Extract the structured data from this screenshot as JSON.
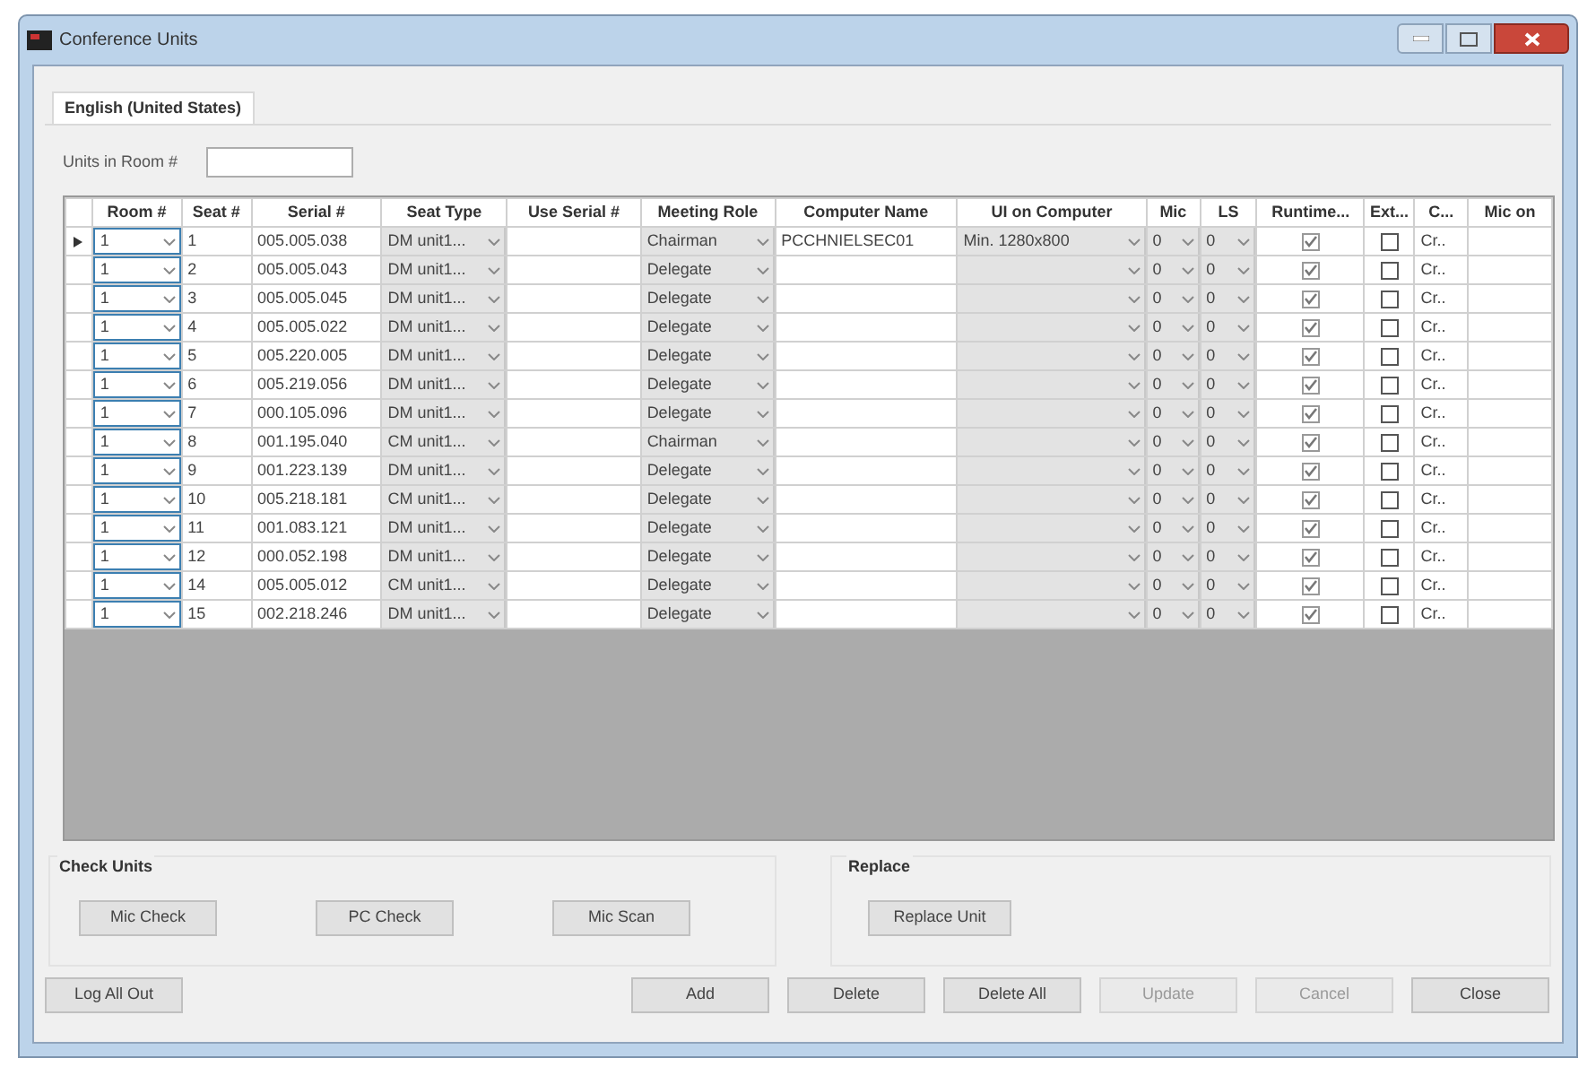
{
  "window": {
    "title": "Conference Units"
  },
  "tab": {
    "label": "English (United States)",
    "selected": true
  },
  "units_in_room": {
    "label": "Units in Room #"
  },
  "table": {
    "columns": [
      {
        "label": "Room #"
      },
      {
        "label": "Seat #"
      },
      {
        "label": "Serial #"
      },
      {
        "label": "Seat Type"
      },
      {
        "label": "Use Serial #"
      },
      {
        "label": "Meeting Role"
      },
      {
        "label": "Computer Name"
      },
      {
        "label": "UI on Computer"
      },
      {
        "label": "Mic"
      },
      {
        "label": "LS"
      },
      {
        "label": "Runtime..."
      },
      {
        "label": "Ext..."
      },
      {
        "label": "C..."
      },
      {
        "label": "Mic on"
      }
    ],
    "rows": [
      {
        "selected": true,
        "room": "1",
        "seat": "1",
        "serial": "005.005.038",
        "seat_type": "DM unit1...",
        "meeting_role": "Chairman",
        "computer_name": "PCCHNIELSEC01",
        "ui_on_computer": "Min. 1280x800",
        "mic": "0",
        "ls": "0",
        "runtime": true,
        "ext": false,
        "c": "Cr.."
      },
      {
        "selected": false,
        "room": "1",
        "seat": "2",
        "serial": "005.005.043",
        "seat_type": "DM unit1...",
        "meeting_role": "Delegate",
        "mic": "0",
        "ls": "0",
        "runtime": true,
        "ext": false,
        "c": "Cr.."
      },
      {
        "selected": false,
        "room": "1",
        "seat": "3",
        "serial": "005.005.045",
        "seat_type": "DM unit1...",
        "meeting_role": "Delegate",
        "mic": "0",
        "ls": "0",
        "runtime": true,
        "ext": false,
        "c": "Cr.."
      },
      {
        "selected": false,
        "room": "1",
        "seat": "4",
        "serial": "005.005.022",
        "seat_type": "DM unit1...",
        "meeting_role": "Delegate",
        "mic": "0",
        "ls": "0",
        "runtime": true,
        "ext": false,
        "c": "Cr.."
      },
      {
        "selected": false,
        "room": "1",
        "seat": "5",
        "serial": "005.220.005",
        "seat_type": "DM unit1...",
        "meeting_role": "Delegate",
        "mic": "0",
        "ls": "0",
        "runtime": true,
        "ext": false,
        "c": "Cr.."
      },
      {
        "selected": false,
        "room": "1",
        "seat": "6",
        "serial": "005.219.056",
        "seat_type": "DM unit1...",
        "meeting_role": "Delegate",
        "mic": "0",
        "ls": "0",
        "runtime": true,
        "ext": false,
        "c": "Cr.."
      },
      {
        "selected": false,
        "room": "1",
        "seat": "7",
        "serial": "000.105.096",
        "seat_type": "DM unit1...",
        "meeting_role": "Delegate",
        "mic": "0",
        "ls": "0",
        "runtime": true,
        "ext": false,
        "c": "Cr.."
      },
      {
        "selected": false,
        "room": "1",
        "seat": "8",
        "serial": "001.195.040",
        "seat_type": "CM unit1...",
        "meeting_role": "Chairman",
        "mic": "0",
        "ls": "0",
        "runtime": true,
        "ext": false,
        "c": "Cr.."
      },
      {
        "selected": false,
        "room": "1",
        "seat": "9",
        "serial": "001.223.139",
        "seat_type": "DM unit1...",
        "meeting_role": "Delegate",
        "mic": "0",
        "ls": "0",
        "runtime": true,
        "ext": false,
        "c": "Cr.."
      },
      {
        "selected": false,
        "room": "1",
        "seat": "10",
        "serial": "005.218.181",
        "seat_type": "CM unit1...",
        "meeting_role": "Delegate",
        "mic": "0",
        "ls": "0",
        "runtime": true,
        "ext": false,
        "c": "Cr.."
      },
      {
        "selected": false,
        "room": "1",
        "seat": "11",
        "serial": "001.083.121",
        "seat_type": "DM unit1...",
        "meeting_role": "Delegate",
        "mic": "0",
        "ls": "0",
        "runtime": true,
        "ext": false,
        "c": "Cr.."
      },
      {
        "selected": false,
        "room": "1",
        "seat": "12",
        "serial": "000.052.198",
        "seat_type": "DM unit1...",
        "meeting_role": "Delegate",
        "mic": "0",
        "ls": "0",
        "runtime": true,
        "ext": false,
        "c": "Cr.."
      },
      {
        "selected": false,
        "room": "1",
        "seat": "14",
        "serial": "005.005.012",
        "seat_type": "CM unit1...",
        "meeting_role": "Delegate",
        "mic": "0",
        "ls": "0",
        "runtime": true,
        "ext": false,
        "c": "Cr.."
      },
      {
        "selected": false,
        "room": "1",
        "seat": "15",
        "serial": "002.218.246",
        "seat_type": "DM unit1...",
        "meeting_role": "Delegate",
        "mic": "0",
        "ls": "0",
        "runtime": true,
        "ext": false,
        "c": "Cr.."
      }
    ]
  },
  "check_units": {
    "title": "Check Units",
    "buttons": [
      {
        "label": "Mic Check"
      },
      {
        "label": "PC Check"
      },
      {
        "label": "Mic Scan"
      }
    ]
  },
  "replace": {
    "title": "Replace",
    "buttons": [
      {
        "label": "Replace Unit"
      }
    ]
  },
  "footer_buttons": [
    {
      "label": "Log All Out",
      "disabled": false
    },
    {
      "label": "Add",
      "disabled": false
    },
    {
      "label": "Delete",
      "disabled": false
    },
    {
      "label": "Delete All",
      "disabled": false
    },
    {
      "label": "Update",
      "disabled": true
    },
    {
      "label": "Cancel",
      "disabled": true
    },
    {
      "label": "Close",
      "disabled": false
    }
  ]
}
